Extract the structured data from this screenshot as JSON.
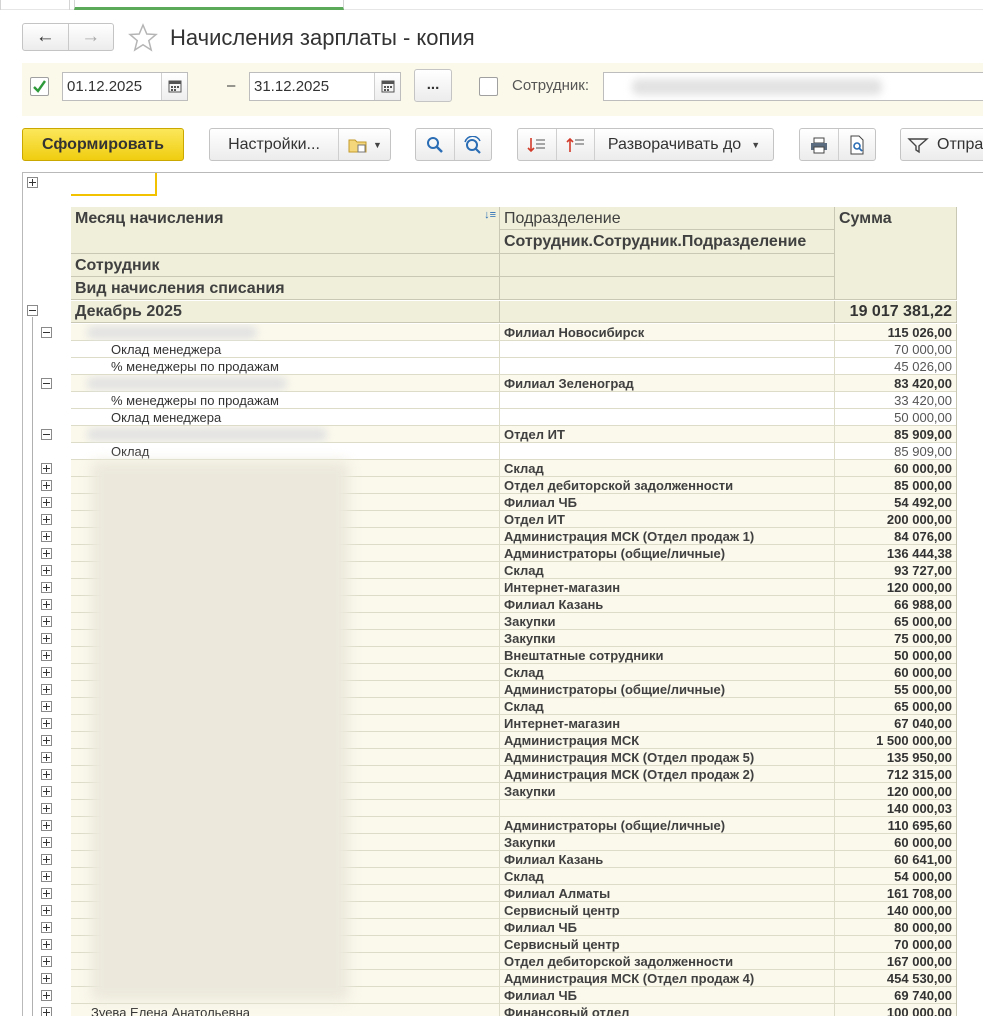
{
  "title": "Начисления зарплаты - копия",
  "nav": {
    "back_icon": "arrow-left-icon",
    "forward_icon": "arrow-right-icon",
    "favorite_icon": "star-icon"
  },
  "filter": {
    "period_enabled": true,
    "date_from": "01.12.2025",
    "date_to": "31.12.2025",
    "dash": "–",
    "more_button": "...",
    "employee_enabled": false,
    "employee_label": "Сотрудник:",
    "employee_value": ""
  },
  "toolbar": {
    "generate": "Сформировать",
    "settings": "Настройки...",
    "expand_to": "Разворачивать до",
    "send": "Отпра"
  },
  "columns": {
    "month": "Месяц начисления",
    "employee": "Сотрудник",
    "accrual_type": "Вид начисления списания",
    "department": "Подразделение",
    "employee_department": "Сотрудник.Сотрудник.Подразделение",
    "sum": "Сумма"
  },
  "group": {
    "label": "Декабрь 2025",
    "total": "19 017 381,22"
  },
  "rows": [
    {
      "type": "emp",
      "dept": "Филиал Новосибирск",
      "sum": "115 026,00",
      "expanded": true,
      "blur_w": 170
    },
    {
      "type": "detail",
      "name": "Оклад менеджера",
      "sum": "70 000,00"
    },
    {
      "type": "detail",
      "name": "% менеджеры по продажам",
      "sum": "45 026,00"
    },
    {
      "type": "emp",
      "dept": "Филиал Зеленоград",
      "sum": "83 420,00",
      "expanded": true,
      "blur_w": 200
    },
    {
      "type": "detail",
      "name": "% менеджеры по продажам",
      "sum": "33 420,00"
    },
    {
      "type": "detail",
      "name": "Оклад менеджера",
      "sum": "50 000,00"
    },
    {
      "type": "emp",
      "dept": "Отдел ИТ",
      "sum": "85 909,00",
      "expanded": true,
      "blur_w": 240
    },
    {
      "type": "detail",
      "name": "Оклад",
      "sum": "85 909,00"
    },
    {
      "type": "emp",
      "dept": "Склад",
      "sum": "60 000,00"
    },
    {
      "type": "emp",
      "dept": "Отдел дебиторской задолженности",
      "sum": "85 000,00"
    },
    {
      "type": "emp",
      "dept": "Филиал ЧБ",
      "sum": "54 492,00"
    },
    {
      "type": "emp",
      "dept": "Отдел ИТ",
      "sum": "200 000,00"
    },
    {
      "type": "emp",
      "dept": "Администрация МСК (Отдел продаж 1)",
      "sum": "84 076,00"
    },
    {
      "type": "emp",
      "dept": "Администраторы (общие/личные)",
      "sum": "136 444,38"
    },
    {
      "type": "emp",
      "dept": "Склад",
      "sum": "93 727,00"
    },
    {
      "type": "emp",
      "dept": "Интернет-магазин",
      "sum": "120 000,00"
    },
    {
      "type": "emp",
      "dept": "Филиал Казань",
      "sum": "66 988,00"
    },
    {
      "type": "emp",
      "dept": "Закупки",
      "sum": "65 000,00"
    },
    {
      "type": "emp",
      "dept": "Закупки",
      "sum": "75 000,00"
    },
    {
      "type": "emp",
      "dept": "Внештатные сотрудники",
      "sum": "50 000,00"
    },
    {
      "type": "emp",
      "dept": "Склад",
      "sum": "60 000,00"
    },
    {
      "type": "emp",
      "dept": "Администраторы (общие/личные)",
      "sum": "55 000,00"
    },
    {
      "type": "emp",
      "dept": "Склад",
      "sum": "65 000,00"
    },
    {
      "type": "emp",
      "dept": "Интернет-магазин",
      "sum": "67 040,00"
    },
    {
      "type": "emp",
      "dept": "Администрация МСК",
      "sum": "1 500 000,00"
    },
    {
      "type": "emp",
      "dept": "Администрация МСК (Отдел продаж 5)",
      "sum": "135 950,00"
    },
    {
      "type": "emp",
      "dept": "Администрация МСК (Отдел продаж 2)",
      "sum": "712 315,00"
    },
    {
      "type": "emp",
      "dept": "Закупки",
      "sum": "120 000,00"
    },
    {
      "type": "emp",
      "dept": "",
      "sum": "140 000,03"
    },
    {
      "type": "emp",
      "dept": "Администраторы (общие/личные)",
      "sum": "110 695,60"
    },
    {
      "type": "emp",
      "dept": "Закупки",
      "sum": "60 000,00"
    },
    {
      "type": "emp",
      "dept": "Филиал Казань",
      "sum": "60 641,00"
    },
    {
      "type": "emp",
      "dept": "Склад",
      "sum": "54 000,00"
    },
    {
      "type": "emp",
      "dept": "Филиал Алматы",
      "sum": "161 708,00"
    },
    {
      "type": "emp",
      "dept": "Сервисный центр",
      "sum": "140 000,00"
    },
    {
      "type": "emp",
      "dept": "Филиал ЧБ",
      "sum": "80 000,00"
    },
    {
      "type": "emp",
      "dept": "Сервисный центр",
      "sum": "70 000,00"
    },
    {
      "type": "emp",
      "dept": "Отдел дебиторской задолженности",
      "sum": "167 000,00"
    },
    {
      "type": "emp",
      "dept": "Администрация МСК (Отдел продаж 4)",
      "sum": "454 530,00"
    },
    {
      "type": "emp",
      "dept": "Филиал ЧБ",
      "sum": "69 740,00"
    },
    {
      "type": "emp",
      "name": "Зуева Елена Анатольевна",
      "dept": "Финансовый отдел",
      "sum": "100 000,00"
    }
  ],
  "colors": {
    "accent_button": "#f5d51c",
    "header_bg": "#efefda",
    "group_row_bg": "#fbf9ec",
    "check_green": "#2e9a3a"
  }
}
